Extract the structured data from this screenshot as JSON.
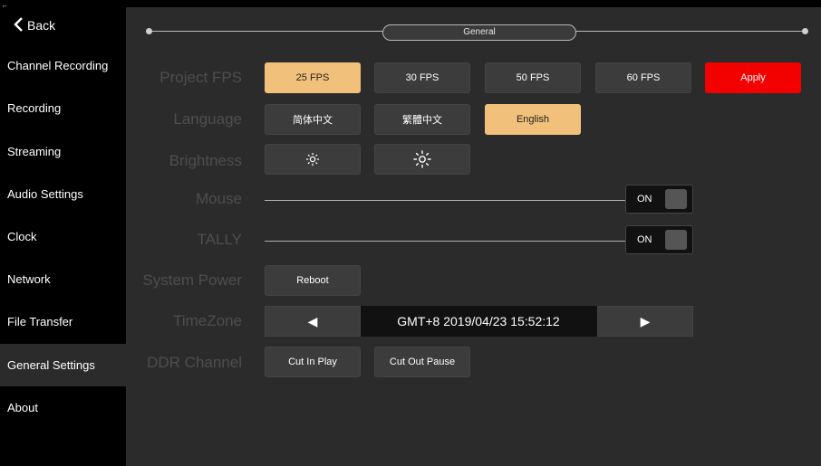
{
  "sidebar": {
    "back_label": "Back",
    "items": [
      {
        "label": "Channel Recording"
      },
      {
        "label": "Recording"
      },
      {
        "label": "Streaming"
      },
      {
        "label": "Audio Settings"
      },
      {
        "label": "Clock"
      },
      {
        "label": "Network"
      },
      {
        "label": "File Transfer"
      },
      {
        "label": "General Settings",
        "active": true
      },
      {
        "label": "About"
      }
    ]
  },
  "header": {
    "title": "General"
  },
  "labels": {
    "project_fps": "Project FPS",
    "language": "Language",
    "brightness": "Brightness",
    "mouse": "Mouse",
    "tally": "TALLY",
    "system_power": "System Power",
    "timezone": "TimeZone",
    "ddr_channel": "DDR Channel"
  },
  "fps": {
    "options": [
      "25 FPS",
      "30 FPS",
      "50 FPS",
      "60 FPS"
    ],
    "selected": "25 FPS",
    "apply_label": "Apply"
  },
  "language": {
    "options": [
      "简体中文",
      "繁體中文",
      "English"
    ],
    "selected": "English"
  },
  "brightness": {
    "decrease_icon": "brightness-low-icon",
    "increase_icon": "brightness-high-icon"
  },
  "mouse": {
    "state": "ON"
  },
  "tally": {
    "state": "ON"
  },
  "system_power": {
    "reboot_label": "Reboot"
  },
  "timezone": {
    "value": "GMT+8 2019/04/23 15:52:12",
    "prev_icon": "◀",
    "next_icon": "▶"
  },
  "ddr": {
    "options": [
      "Cut In Play",
      "Cut Out Pause"
    ]
  },
  "colors": {
    "accent": "#f1c07a",
    "apply": "#f30000",
    "panel": "#2b2b2b"
  }
}
